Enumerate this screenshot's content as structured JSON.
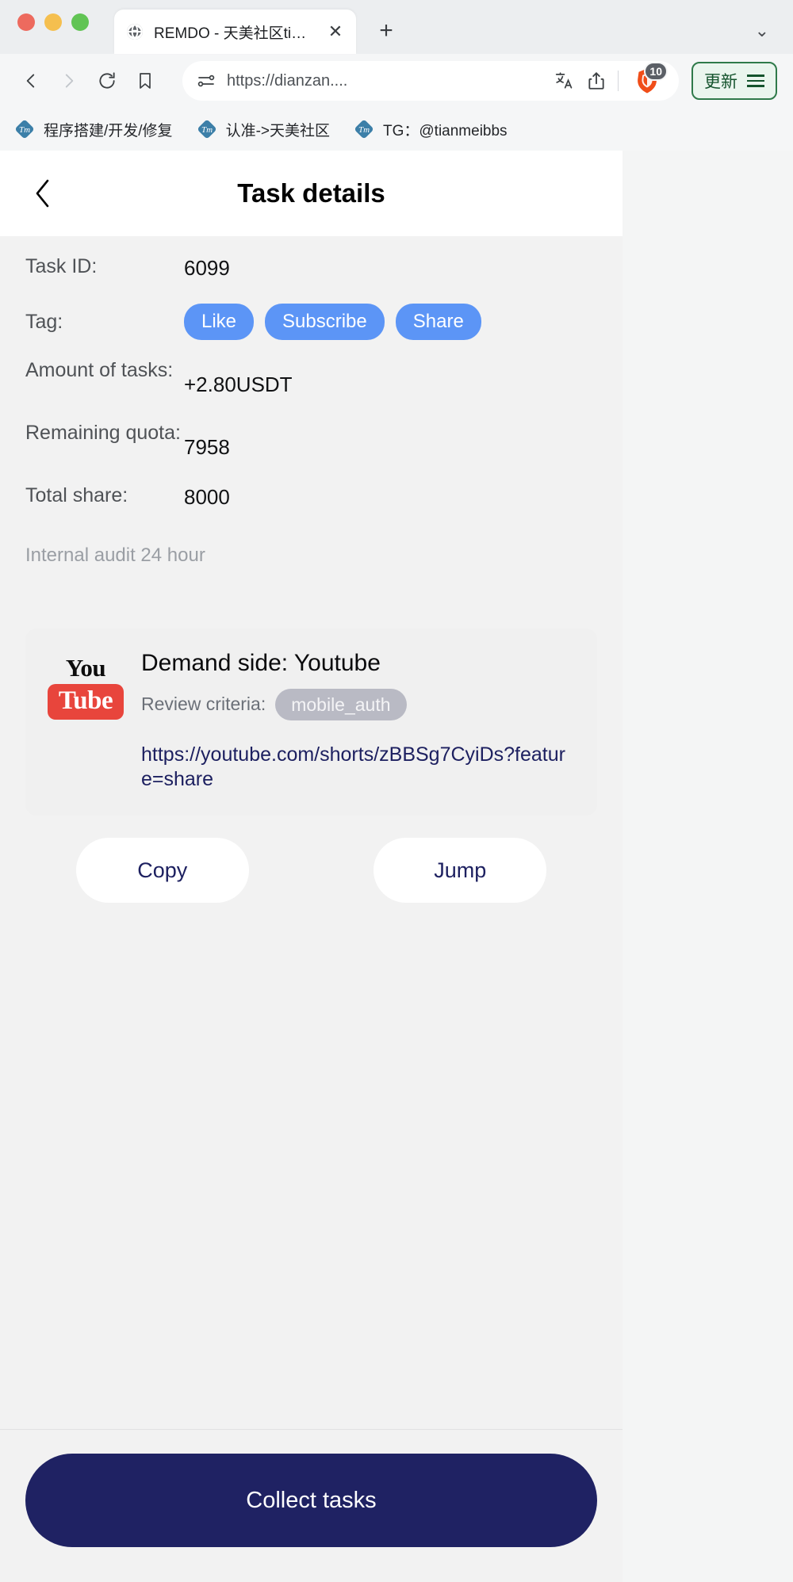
{
  "browser": {
    "tab": {
      "title": "REMDO - 天美社区timibbs.net",
      "favicon": "globe-icon",
      "close": "✕"
    },
    "new_tab": "+",
    "tabstrip_chevron": "⌄",
    "toolbar": {
      "back": "‹",
      "forward": "›",
      "reload": "reload-icon",
      "bookmark": "bookmark-icon",
      "permissions": "permissions-icon",
      "url": "https://dianzan....",
      "translate": "translate-icon",
      "share": "share-icon",
      "shield_count": "10",
      "update_label": "更新",
      "menu": "hamburger-icon"
    },
    "bookmarks": [
      {
        "label": "程序搭建/开发/修复",
        "icon": "tm-favicon"
      },
      {
        "label": "认准->天美社区",
        "icon": "tm-favicon"
      },
      {
        "label": "TG：@tianmeibbs",
        "icon": "tm-favicon"
      }
    ]
  },
  "page": {
    "header": {
      "back_icon": "chevron-left-icon",
      "title": "Task details"
    },
    "info": [
      {
        "label": "Task ID:",
        "value": "6099"
      },
      {
        "label": "Amount of tasks:",
        "value": "+2.80USDT"
      },
      {
        "label": "Remaining quota:",
        "value": "7958"
      },
      {
        "label": "Total share:",
        "value": "8000"
      }
    ],
    "tag": {
      "label": "Tag:",
      "pills": [
        "Like",
        "Subscribe",
        "Share"
      ]
    },
    "audit_note": "Internal audit 24 hour",
    "demand_card": {
      "logo_top": "You",
      "logo_bottom": "Tube",
      "title": "Demand side: Youtube",
      "review_label": "Review criteria:",
      "review_chip": "mobile_auth",
      "url": "https://youtube.com/shorts/zBBSg7CyiDs?feature=share"
    },
    "actions": {
      "copy": "Copy",
      "jump": "Jump"
    },
    "collect": "Collect tasks"
  },
  "colors": {
    "tag_pill": "#5c95f6",
    "youtube_red": "#e8453c",
    "primary_navy": "#1f2263",
    "review_chip": "#b9bac4",
    "update_green": "#2f7a4a"
  }
}
